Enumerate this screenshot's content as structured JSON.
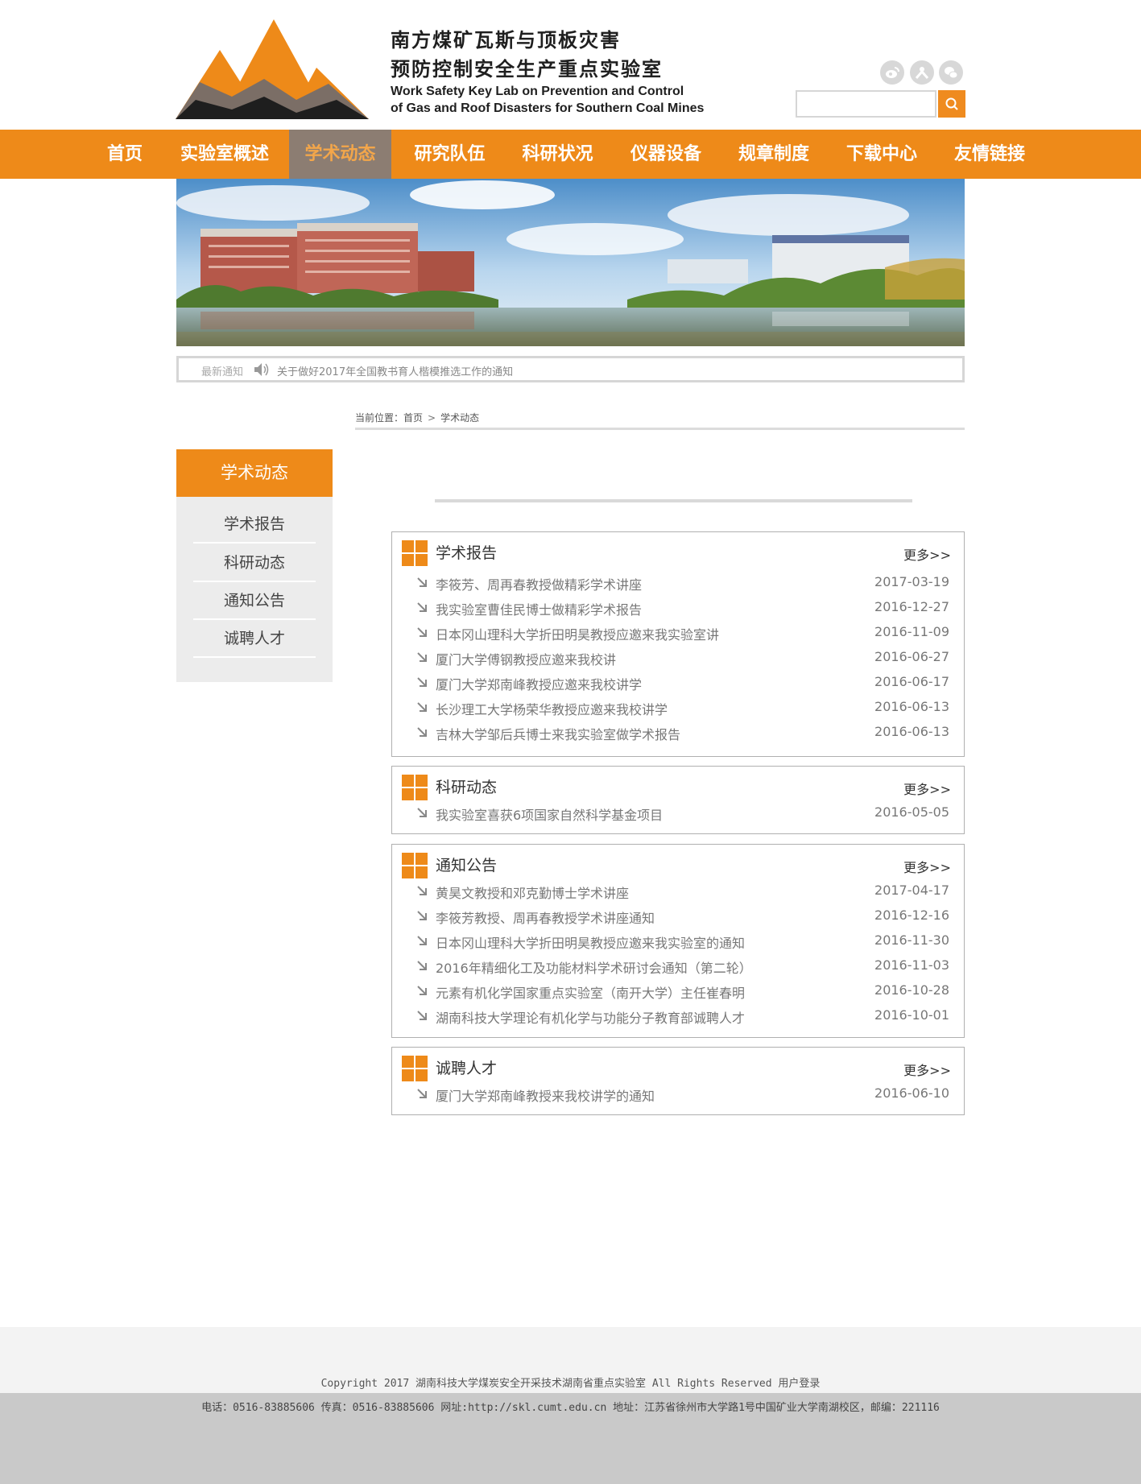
{
  "header": {
    "title_cn_line1": "南方煤矿瓦斯与顶板灾害",
    "title_cn_line2": "预防控制安全生产重点实验室",
    "title_en_line1": "Work Safety Key Lab on Prevention and Control",
    "title_en_line2": "of Gas and Roof Disasters for Southern Coal Mines",
    "social_icons": [
      "weibo-icon",
      "renren-icon",
      "wechat-icon"
    ],
    "search_value": "",
    "search_icon": "search-icon"
  },
  "colors": {
    "accent": "#ee8a19",
    "nav_active_bg": "#8c7d72",
    "nav_active_text": "#f3a64a"
  },
  "nav": {
    "items": [
      {
        "label": "首页"
      },
      {
        "label": "实验室概述"
      },
      {
        "label": "学术动态"
      },
      {
        "label": "研究队伍"
      },
      {
        "label": "科研状况"
      },
      {
        "label": "仪器设备"
      },
      {
        "label": "规章制度"
      },
      {
        "label": "下载中心"
      },
      {
        "label": "友情链接"
      }
    ],
    "active_index": 2
  },
  "notice": {
    "label": "最新通知",
    "text": "关于做好2017年全国教书育人楷模推选工作的通知"
  },
  "breadcrumb": {
    "prefix": "当前位置：",
    "home": "首页",
    "current": "学术动态"
  },
  "sidebar": {
    "title": "学术动态",
    "items": [
      {
        "label": "学术报告"
      },
      {
        "label": "科研动态"
      },
      {
        "label": "通知公告"
      },
      {
        "label": "诚聘人才"
      }
    ]
  },
  "sections": [
    {
      "title": "学术报告",
      "more": "更多>>",
      "rows": [
        {
          "title": "李筱芳、周再春教授做精彩学术讲座",
          "date": "2017-03-19"
        },
        {
          "title": "我实验室曹佳民博士做精彩学术报告",
          "date": "2016-12-27"
        },
        {
          "title": "日本冈山理科大学折田明昊教授应邀来我实验室讲",
          "date": "2016-11-09"
        },
        {
          "title": "厦门大学傅钢教授应邀来我校讲",
          "date": "2016-06-27"
        },
        {
          "title": "厦门大学郑南峰教授应邀来我校讲学",
          "date": "2016-06-17"
        },
        {
          "title": "长沙理工大学杨荣华教授应邀来我校讲学",
          "date": "2016-06-13"
        },
        {
          "title": "吉林大学邹后兵博士来我实验室做学术报告",
          "date": "2016-06-13"
        }
      ]
    },
    {
      "title": "科研动态",
      "more": "更多>>",
      "rows": [
        {
          "title": "我实验室喜获6项国家自然科学基金项目",
          "date": "2016-05-05"
        }
      ]
    },
    {
      "title": "通知公告",
      "more": "更多>>",
      "rows": [
        {
          "title": "黄昊文教授和邓克勤博士学术讲座",
          "date": "2017-04-17"
        },
        {
          "title": "李筱芳教授、周再春教授学术讲座通知",
          "date": "2016-12-16"
        },
        {
          "title": "日本冈山理科大学折田明昊教授应邀来我实验室的通知",
          "date": "2016-11-30"
        },
        {
          "title": "2016年精细化工及功能材料学术研讨会通知（第二轮）",
          "date": "2016-11-03"
        },
        {
          "title": "元素有机化学国家重点实验室（南开大学）主任崔春明",
          "date": "2016-10-28"
        },
        {
          "title": "湖南科技大学理论有机化学与功能分子教育部诚聘人才",
          "date": "2016-10-01"
        }
      ]
    },
    {
      "title": "诚聘人才",
      "more": "更多>>",
      "rows": [
        {
          "title": "厦门大学郑南峰教授来我校讲学的通知",
          "date": "2016-06-10"
        }
      ]
    }
  ],
  "footer": {
    "copyright": "Copyright 2017 湖南科技大学煤炭安全开采技术湖南省重点实验室 All Rights Reserved 用户登录",
    "contact": "电话：0516-83885606 传真：0516-83885606 网址:http://skl.cumt.edu.cn 地址：江苏省徐州市大学路1号中国矿业大学南湖校区，邮编：221116"
  }
}
